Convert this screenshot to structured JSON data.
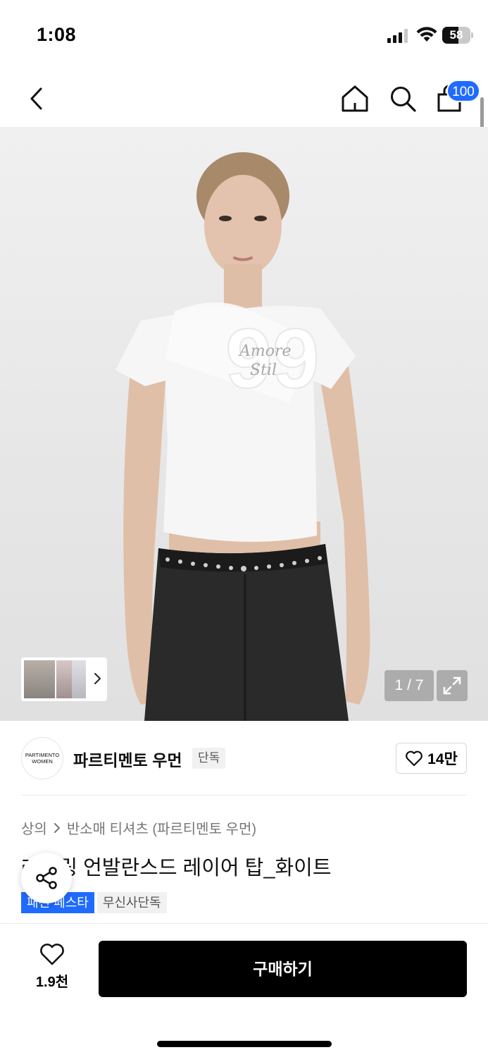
{
  "status_bar": {
    "time": "1:08",
    "battery_level": "58",
    "battery_fraction": 0.58
  },
  "nav": {
    "cart_count": "100",
    "icons": [
      "back-chevron-icon",
      "home-icon",
      "search-icon",
      "shopping-bag-icon"
    ]
  },
  "gallery": {
    "page_indicator": "1 / 7",
    "current_page": 1,
    "total_pages": 7
  },
  "brand": {
    "logo_line1": "PARTIMENTO",
    "logo_line2": "WOMEN",
    "name": "파르티멘토 우먼",
    "badge": "단독",
    "like_count": "14만"
  },
  "breadcrumb": {
    "category": "상의",
    "subcategory": "반소매 티셔츠 (파르티멘토 우먼)"
  },
  "product": {
    "title": "레터링 언발란스드 레이어 탑_화이트",
    "tags": [
      "패션 페스타",
      "무신사단독"
    ]
  },
  "bottom_bar": {
    "like_count": "1.9천",
    "buy_label": "구매하기"
  },
  "colors": {
    "accent_blue": "#1f6bff",
    "buy_button": "#000000"
  }
}
